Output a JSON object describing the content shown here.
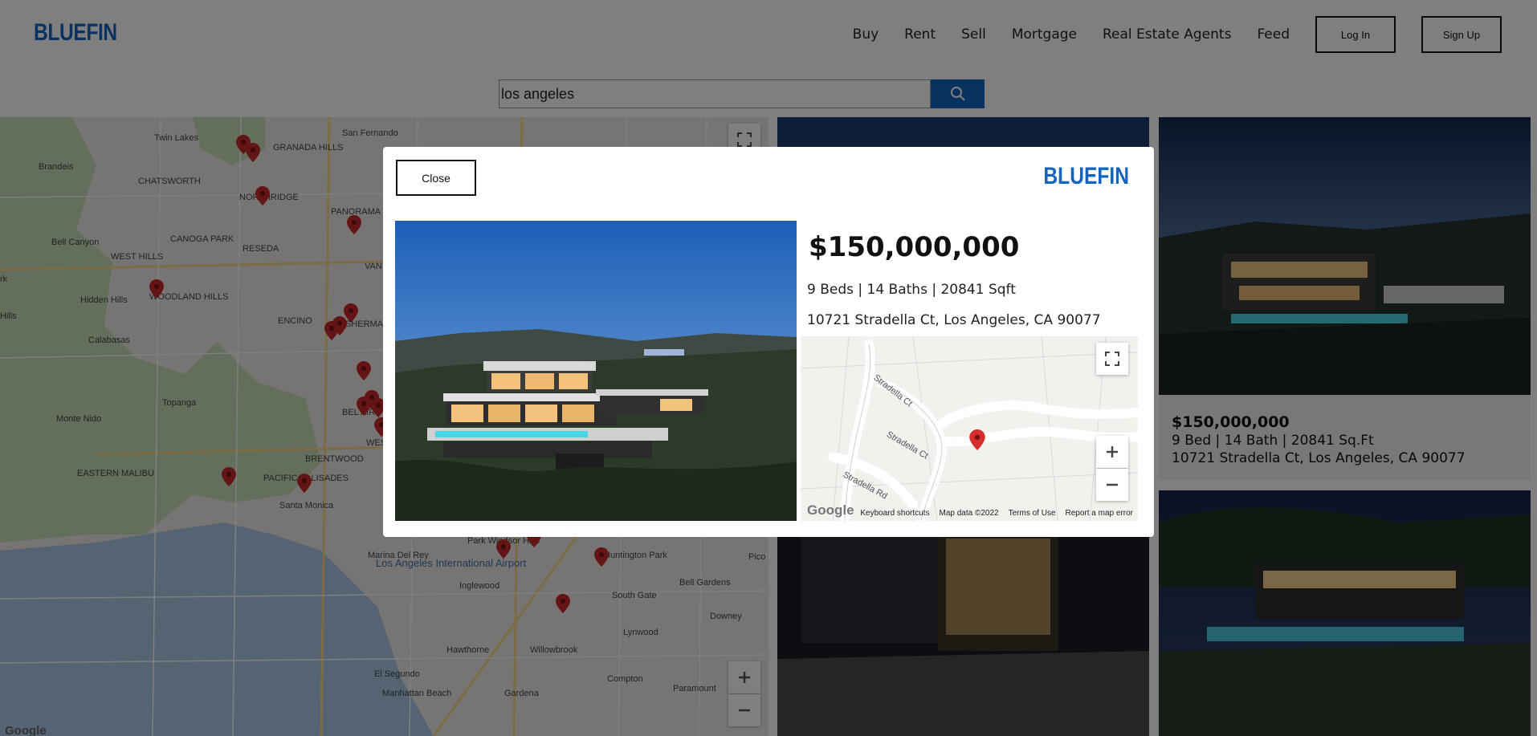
{
  "header": {
    "logo": "BLUEFIN",
    "nav": [
      "Buy",
      "Rent",
      "Sell",
      "Mortgage",
      "Real Estate Agents",
      "Feed"
    ],
    "login_label": "Log In",
    "signup_label": "Sign Up"
  },
  "search": {
    "value": "los angeles",
    "icon": "search-icon"
  },
  "map": {
    "places": [
      {
        "name": "Twin Lakes"
      },
      {
        "name": "GRANADA HILLS"
      },
      {
        "name": "San Fernando"
      },
      {
        "name": "Brandeis"
      },
      {
        "name": "CHATSWORTH"
      },
      {
        "name": "NORTHRIDGE"
      },
      {
        "name": "PANORAMA CITY"
      },
      {
        "name": "Bell Canyon"
      },
      {
        "name": "CANOGA PARK"
      },
      {
        "name": "WEST HILLS"
      },
      {
        "name": "RESEDA"
      },
      {
        "name": "VAN NUYS"
      },
      {
        "name": "Hidden Hills"
      },
      {
        "name": "WOODLAND HILLS"
      },
      {
        "name": "ENCINO"
      },
      {
        "name": "Calabasas"
      },
      {
        "name": "SHERMAN OAKS"
      },
      {
        "name": "Topanga"
      },
      {
        "name": "BEL AIR"
      },
      {
        "name": "Monte Nido"
      },
      {
        "name": "WESTWOOD"
      },
      {
        "name": "BRENTWOOD"
      },
      {
        "name": "EASTERN MALIBU"
      },
      {
        "name": "PACIFIC PALISADES"
      },
      {
        "name": "Santa Monica"
      },
      {
        "name": "Marina Del Rey"
      },
      {
        "name": "Los Angeles International Airport"
      },
      {
        "name": "Park Windsor Hills"
      },
      {
        "name": "Inglewood"
      },
      {
        "name": "Huntington Park"
      },
      {
        "name": "South Gate"
      },
      {
        "name": "Bell Gardens"
      },
      {
        "name": "Downey"
      },
      {
        "name": "Pico"
      },
      {
        "name": "Lynwood"
      },
      {
        "name": "Hawthorne"
      },
      {
        "name": "Willowbrook"
      },
      {
        "name": "El Segundo"
      },
      {
        "name": "Compton"
      },
      {
        "name": "Paramount"
      },
      {
        "name": "Manhattan Beach"
      },
      {
        "name": "Gardena"
      },
      {
        "name": "rk"
      },
      {
        "name": "Hills"
      }
    ],
    "google_label": "Google"
  },
  "listings": [
    {
      "price": "$150,000,000",
      "specs": "9 Bed | 14 Bath | 20841 Sq.Ft",
      "address": "10721 Stradella Ct, Los Angeles, CA 90077"
    }
  ],
  "modal": {
    "close_label": "Close",
    "logo": "BLUEFIN",
    "price": "$150,000,000",
    "specs": "9 Beds | 14 Baths | 20841 Sqft",
    "address": "10721 Stradella Ct, Los Angeles, CA 90077",
    "minimap": {
      "streets": [
        "Stradella Ct",
        "Stradella Ct",
        "Stradella Rd"
      ],
      "google_label": "Google",
      "footer_links": [
        "Keyboard shortcuts",
        "Map data ©2022",
        "Terms of Use",
        "Report a map error"
      ]
    }
  },
  "colors": {
    "brand": "#1565c0",
    "pin": "#c62828",
    "overlay": "rgba(0,0,0,0.5)"
  }
}
